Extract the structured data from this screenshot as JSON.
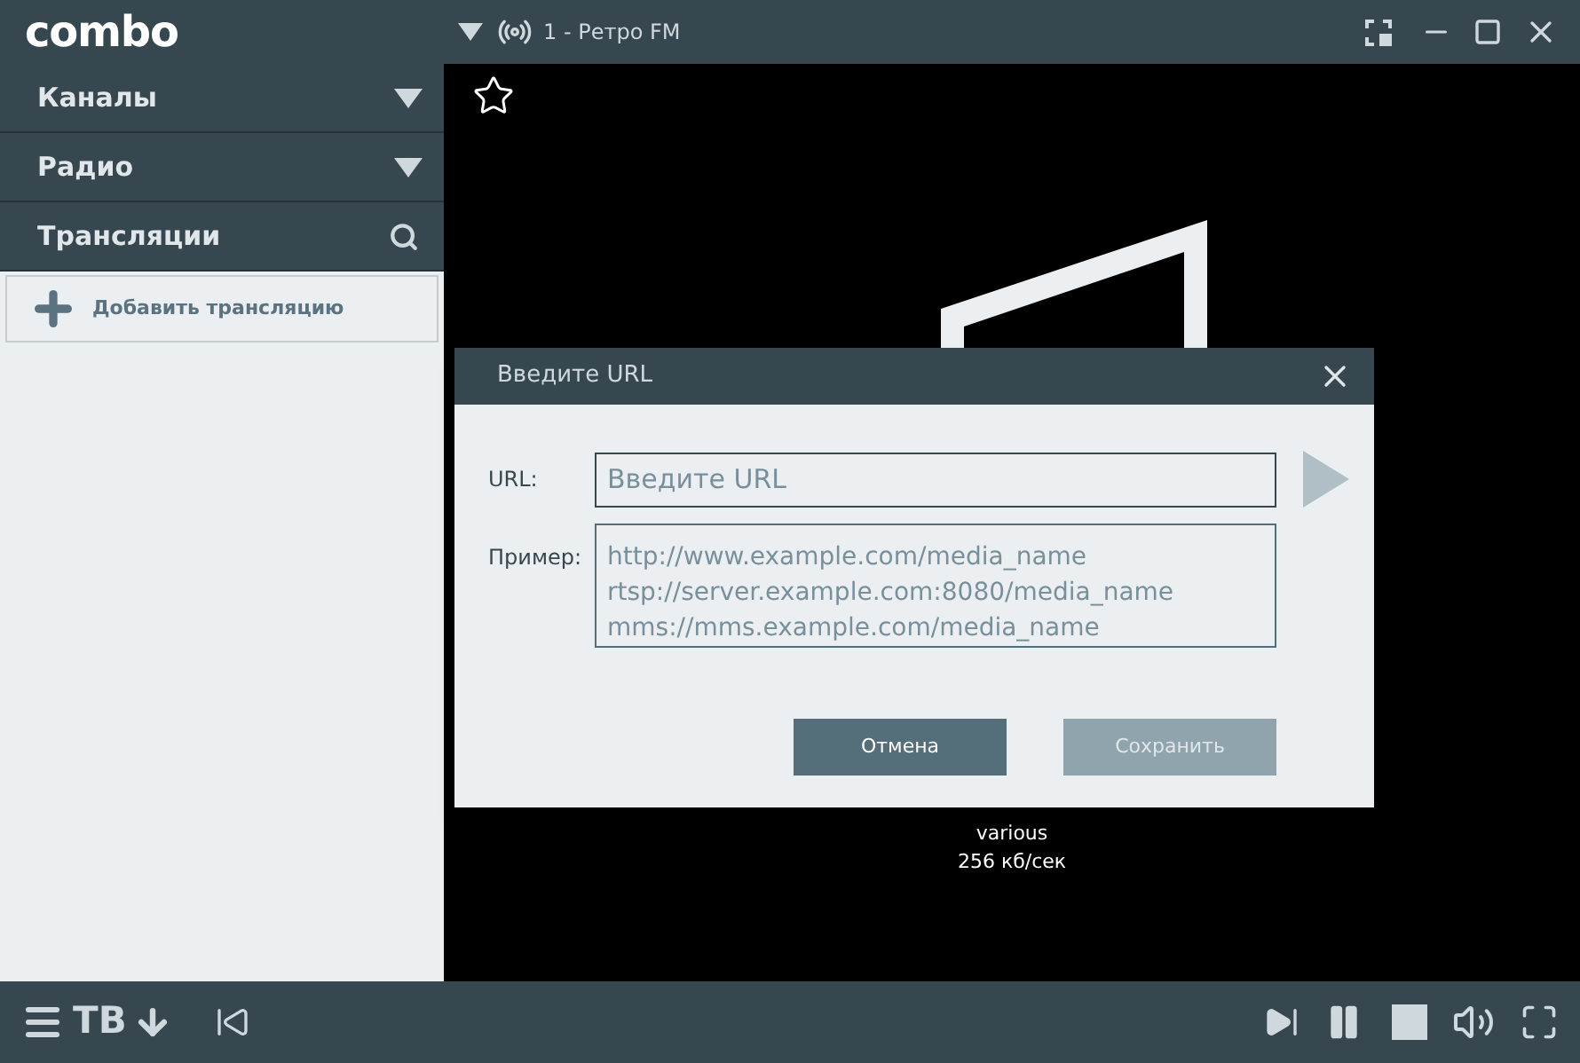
{
  "app": {
    "logo": "combo",
    "now_playing": "1 - Ретро FM"
  },
  "sidebar": {
    "sections": [
      {
        "label": "Каналы",
        "kind": "dropdown"
      },
      {
        "label": "Радио",
        "kind": "dropdown"
      },
      {
        "label": "Трансляции",
        "kind": "search"
      }
    ],
    "add_button": "Добавить трансляцию"
  },
  "player": {
    "track_info": [
      "various",
      "256 кб/сек"
    ]
  },
  "dialog": {
    "title": "Введите URL",
    "url_label": "URL:",
    "url_field": {
      "placeholder": "Введите URL"
    },
    "example_label": "Пример:",
    "examples": [
      "http://www.example.com/media_name",
      "rtsp://server.example.com:8080/media_name",
      "mms://mms.example.com/media_name"
    ],
    "buttons": [
      {
        "label": "Отмена",
        "disabled": false
      },
      {
        "label": "Сохранить",
        "disabled": true
      }
    ]
  },
  "bottom_bar": {
    "mode": "ТВ"
  }
}
